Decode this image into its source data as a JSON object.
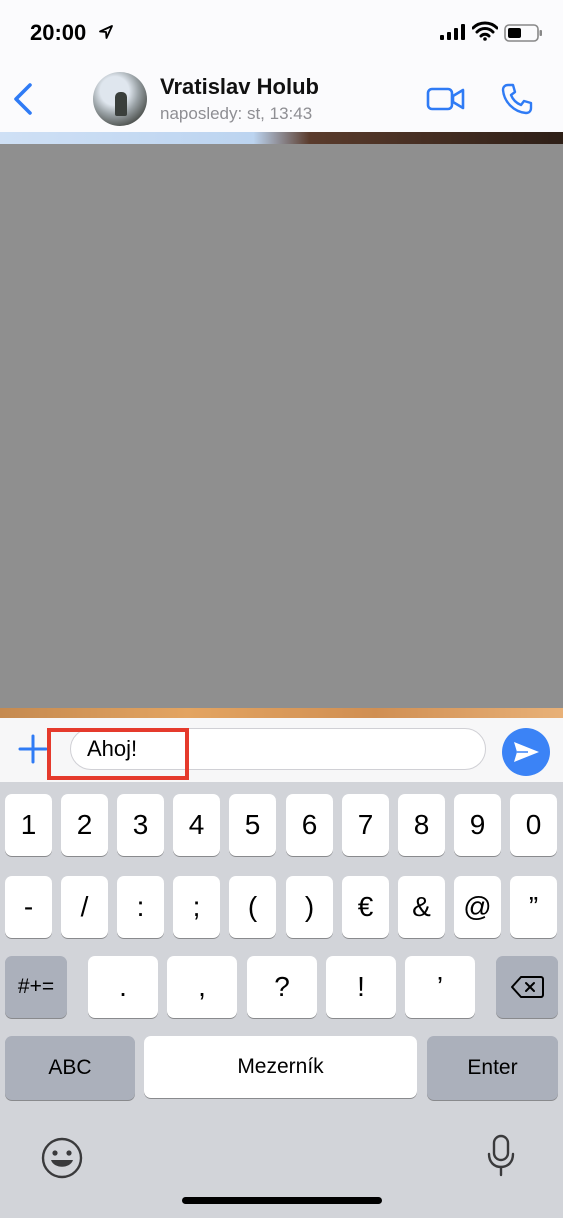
{
  "status": {
    "time": "20:00"
  },
  "header": {
    "contact_name": "Vratislav Holub",
    "last_seen": "naposledy: st, 13:43"
  },
  "composer": {
    "text": "Ahoj!"
  },
  "keyboard": {
    "row1": [
      "1",
      "2",
      "3",
      "4",
      "5",
      "6",
      "7",
      "8",
      "9",
      "0"
    ],
    "row2": [
      "-",
      "/",
      ":",
      ";",
      "(",
      ")",
      "€",
      "&",
      "@",
      "”"
    ],
    "row3": [
      ".",
      ",",
      "?",
      "!",
      "’"
    ],
    "toggle_symbols": "#+=",
    "toggle_abc": "ABC",
    "space": "Mezerník",
    "enter": "Enter"
  },
  "colors": {
    "accent": "#3b83f6",
    "highlight": "#e53a2c"
  }
}
